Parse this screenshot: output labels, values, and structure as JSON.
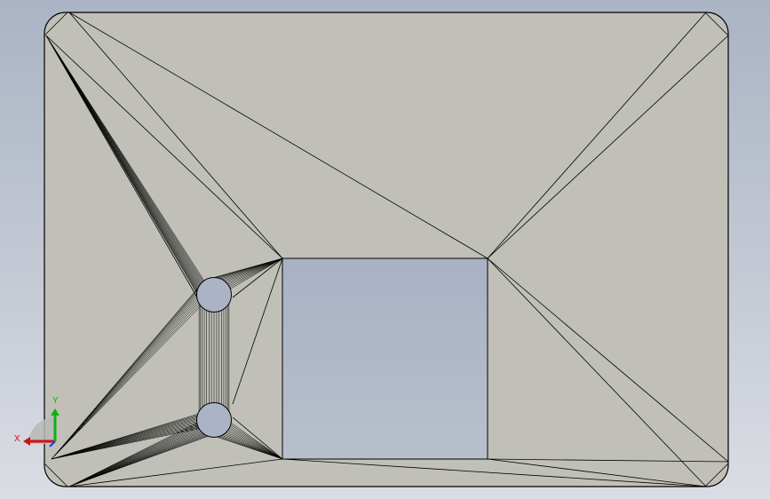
{
  "viewport": {
    "background_top": "#aab4c4",
    "background_bottom": "#dadde3"
  },
  "part": {
    "face_color": "#c0c0b8",
    "edge_color": "#000000",
    "pocket_color": "#aab4c6",
    "description_icon": "mesh-plate-icon"
  },
  "triad": {
    "x_label": "X",
    "y_label": "Y",
    "x_color": "#d01010",
    "y_color": "#10b010",
    "z_color": "#1040e0"
  }
}
